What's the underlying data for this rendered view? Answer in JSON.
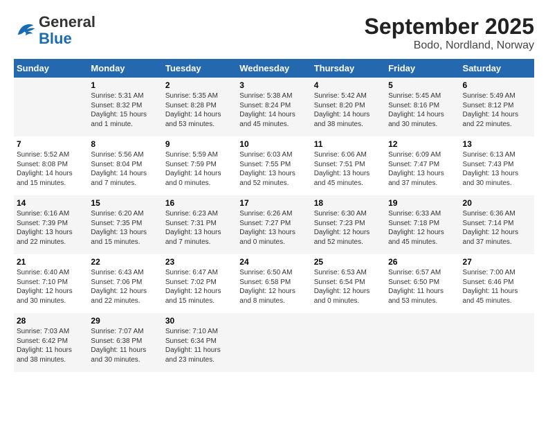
{
  "header": {
    "logo": {
      "general": "General",
      "blue": "Blue"
    },
    "title": "September 2025",
    "location": "Bodo, Nordland, Norway"
  },
  "weekdays": [
    "Sunday",
    "Monday",
    "Tuesday",
    "Wednesday",
    "Thursday",
    "Friday",
    "Saturday"
  ],
  "weeks": [
    [
      {
        "day": "",
        "info": ""
      },
      {
        "day": "1",
        "info": "Sunrise: 5:31 AM\nSunset: 8:32 PM\nDaylight: 15 hours\nand 1 minute."
      },
      {
        "day": "2",
        "info": "Sunrise: 5:35 AM\nSunset: 8:28 PM\nDaylight: 14 hours\nand 53 minutes."
      },
      {
        "day": "3",
        "info": "Sunrise: 5:38 AM\nSunset: 8:24 PM\nDaylight: 14 hours\nand 45 minutes."
      },
      {
        "day": "4",
        "info": "Sunrise: 5:42 AM\nSunset: 8:20 PM\nDaylight: 14 hours\nand 38 minutes."
      },
      {
        "day": "5",
        "info": "Sunrise: 5:45 AM\nSunset: 8:16 PM\nDaylight: 14 hours\nand 30 minutes."
      },
      {
        "day": "6",
        "info": "Sunrise: 5:49 AM\nSunset: 8:12 PM\nDaylight: 14 hours\nand 22 minutes."
      }
    ],
    [
      {
        "day": "7",
        "info": "Sunrise: 5:52 AM\nSunset: 8:08 PM\nDaylight: 14 hours\nand 15 minutes."
      },
      {
        "day": "8",
        "info": "Sunrise: 5:56 AM\nSunset: 8:04 PM\nDaylight: 14 hours\nand 7 minutes."
      },
      {
        "day": "9",
        "info": "Sunrise: 5:59 AM\nSunset: 7:59 PM\nDaylight: 14 hours\nand 0 minutes."
      },
      {
        "day": "10",
        "info": "Sunrise: 6:03 AM\nSunset: 7:55 PM\nDaylight: 13 hours\nand 52 minutes."
      },
      {
        "day": "11",
        "info": "Sunrise: 6:06 AM\nSunset: 7:51 PM\nDaylight: 13 hours\nand 45 minutes."
      },
      {
        "day": "12",
        "info": "Sunrise: 6:09 AM\nSunset: 7:47 PM\nDaylight: 13 hours\nand 37 minutes."
      },
      {
        "day": "13",
        "info": "Sunrise: 6:13 AM\nSunset: 7:43 PM\nDaylight: 13 hours\nand 30 minutes."
      }
    ],
    [
      {
        "day": "14",
        "info": "Sunrise: 6:16 AM\nSunset: 7:39 PM\nDaylight: 13 hours\nand 22 minutes."
      },
      {
        "day": "15",
        "info": "Sunrise: 6:20 AM\nSunset: 7:35 PM\nDaylight: 13 hours\nand 15 minutes."
      },
      {
        "day": "16",
        "info": "Sunrise: 6:23 AM\nSunset: 7:31 PM\nDaylight: 13 hours\nand 7 minutes."
      },
      {
        "day": "17",
        "info": "Sunrise: 6:26 AM\nSunset: 7:27 PM\nDaylight: 13 hours\nand 0 minutes."
      },
      {
        "day": "18",
        "info": "Sunrise: 6:30 AM\nSunset: 7:23 PM\nDaylight: 12 hours\nand 52 minutes."
      },
      {
        "day": "19",
        "info": "Sunrise: 6:33 AM\nSunset: 7:18 PM\nDaylight: 12 hours\nand 45 minutes."
      },
      {
        "day": "20",
        "info": "Sunrise: 6:36 AM\nSunset: 7:14 PM\nDaylight: 12 hours\nand 37 minutes."
      }
    ],
    [
      {
        "day": "21",
        "info": "Sunrise: 6:40 AM\nSunset: 7:10 PM\nDaylight: 12 hours\nand 30 minutes."
      },
      {
        "day": "22",
        "info": "Sunrise: 6:43 AM\nSunset: 7:06 PM\nDaylight: 12 hours\nand 22 minutes."
      },
      {
        "day": "23",
        "info": "Sunrise: 6:47 AM\nSunset: 7:02 PM\nDaylight: 12 hours\nand 15 minutes."
      },
      {
        "day": "24",
        "info": "Sunrise: 6:50 AM\nSunset: 6:58 PM\nDaylight: 12 hours\nand 8 minutes."
      },
      {
        "day": "25",
        "info": "Sunrise: 6:53 AM\nSunset: 6:54 PM\nDaylight: 12 hours\nand 0 minutes."
      },
      {
        "day": "26",
        "info": "Sunrise: 6:57 AM\nSunset: 6:50 PM\nDaylight: 11 hours\nand 53 minutes."
      },
      {
        "day": "27",
        "info": "Sunrise: 7:00 AM\nSunset: 6:46 PM\nDaylight: 11 hours\nand 45 minutes."
      }
    ],
    [
      {
        "day": "28",
        "info": "Sunrise: 7:03 AM\nSunset: 6:42 PM\nDaylight: 11 hours\nand 38 minutes."
      },
      {
        "day": "29",
        "info": "Sunrise: 7:07 AM\nSunset: 6:38 PM\nDaylight: 11 hours\nand 30 minutes."
      },
      {
        "day": "30",
        "info": "Sunrise: 7:10 AM\nSunset: 6:34 PM\nDaylight: 11 hours\nand 23 minutes."
      },
      {
        "day": "",
        "info": ""
      },
      {
        "day": "",
        "info": ""
      },
      {
        "day": "",
        "info": ""
      },
      {
        "day": "",
        "info": ""
      }
    ]
  ]
}
